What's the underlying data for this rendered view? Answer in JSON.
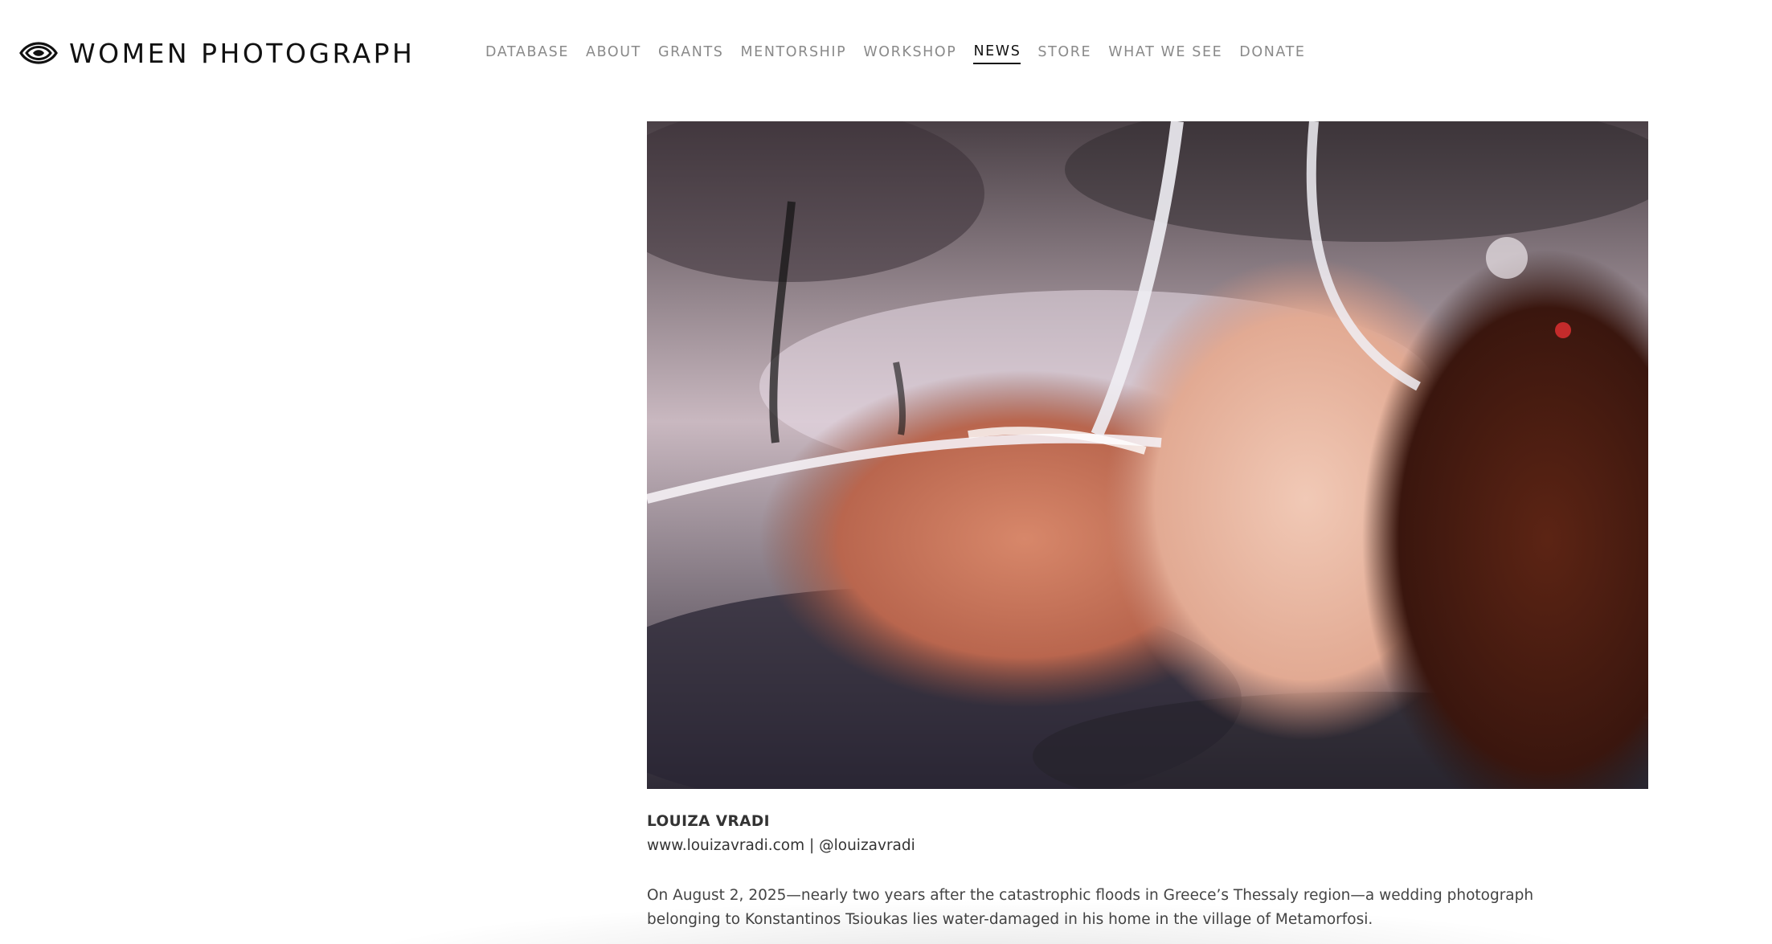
{
  "site": {
    "logo_text": "WOMEN PHOTOGRAPH",
    "logo_icon": "eye-icon"
  },
  "nav": {
    "items": [
      {
        "label": "DATABASE",
        "active": false
      },
      {
        "label": "ABOUT",
        "active": false
      },
      {
        "label": "GRANTS",
        "active": false
      },
      {
        "label": "MENTORSHIP",
        "active": false
      },
      {
        "label": "WORKSHOP",
        "active": false
      },
      {
        "label": "NEWS",
        "active": true
      },
      {
        "label": "STORE",
        "active": false
      },
      {
        "label": "WHAT WE SEE",
        "active": false
      },
      {
        "label": "DONATE",
        "active": false
      }
    ]
  },
  "article": {
    "photographer": "LOUIZA VRADI",
    "website": "www.louizavradi.com",
    "separator": " | ",
    "handle": "@louizavradi",
    "body": "On August 2, 2025—nearly two years after the catastrophic floods in Greece’s Thessaly region—a wedding photograph belonging to Konstantinos Tsioukas lies water-damaged in his home in the village of Metamorfosi."
  },
  "colors": {
    "nav_text": "#8a8a8a",
    "nav_active": "#111111",
    "text": "#333333"
  }
}
